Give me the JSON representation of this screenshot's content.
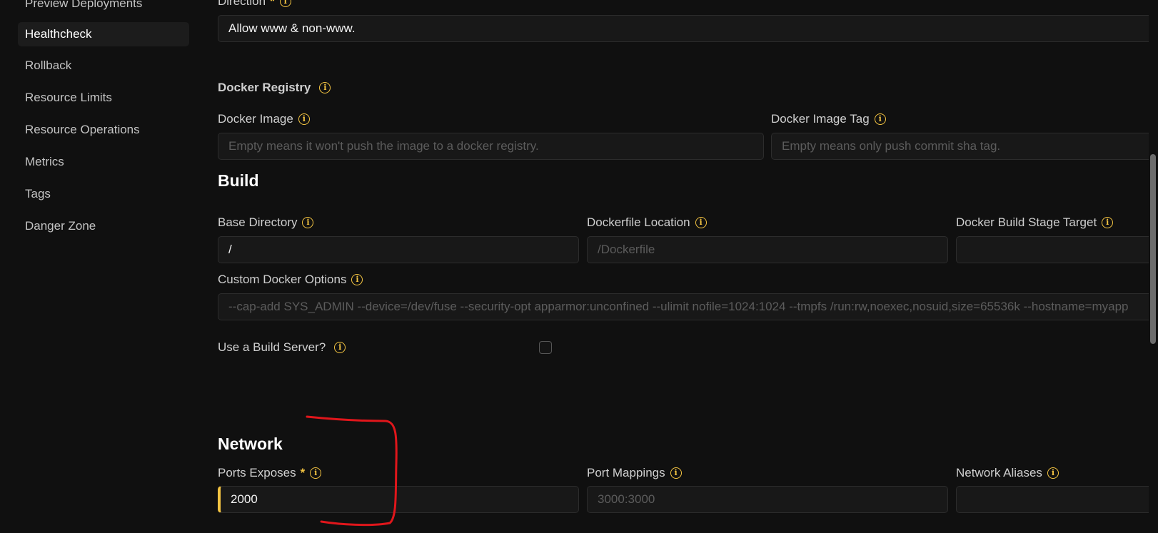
{
  "sidebar": {
    "items": [
      {
        "label": "Preview Deployments"
      },
      {
        "label": "Healthcheck",
        "active": true
      },
      {
        "label": "Rollback"
      },
      {
        "label": "Resource Limits"
      },
      {
        "label": "Resource Operations"
      },
      {
        "label": "Metrics"
      },
      {
        "label": "Tags"
      },
      {
        "label": "Danger Zone"
      }
    ]
  },
  "direction": {
    "label": "Direction",
    "required_mark": "*",
    "value": "Allow www & non-www."
  },
  "docker_registry": {
    "title": "Docker Registry",
    "image": {
      "label": "Docker Image",
      "placeholder": "Empty means it won't push the image to a docker registry."
    },
    "tag": {
      "label": "Docker Image Tag",
      "placeholder": "Empty means only push commit sha tag."
    }
  },
  "build": {
    "title": "Build",
    "base_directory": {
      "label": "Base Directory",
      "value": "/"
    },
    "dockerfile_location": {
      "label": "Dockerfile Location",
      "placeholder": "/Dockerfile"
    },
    "build_stage_target": {
      "label": "Docker Build Stage Target",
      "value": ""
    },
    "custom_options": {
      "label": "Custom Docker Options",
      "placeholder": "--cap-add SYS_ADMIN --device=/dev/fuse --security-opt apparmor:unconfined --ulimit nofile=1024:1024 --tmpfs /run:rw,noexec,nosuid,size=65536k --hostname=myapp"
    },
    "build_server": {
      "label": "Use a Build Server?",
      "checked": false
    }
  },
  "network": {
    "title": "Network",
    "ports_exposes": {
      "label": "Ports Exposes",
      "required_mark": "*",
      "value": "2000"
    },
    "port_mappings": {
      "label": "Port Mappings",
      "placeholder": "3000:3000"
    },
    "network_aliases": {
      "label": "Network Aliases",
      "value": ""
    }
  },
  "colors": {
    "background": "#101010",
    "accent": "#f5c542",
    "annotation": "#e0161b"
  },
  "icons": [
    "info-icon",
    "checkbox"
  ]
}
